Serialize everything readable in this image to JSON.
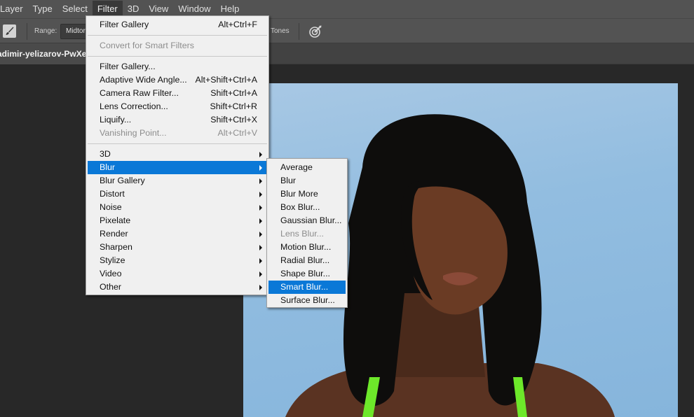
{
  "menubar": {
    "items": [
      "Layer",
      "Type",
      "Select",
      "Filter",
      "3D",
      "View",
      "Window",
      "Help"
    ],
    "active": "Filter"
  },
  "options_bar": {
    "tool_icon": "brush-icon",
    "range_label": "Range:",
    "range_value": "Midtones",
    "range_visible_text": "Midtor",
    "tones_label": "Tones",
    "airbrush_icon": "target-airbrush-icon"
  },
  "document": {
    "tab_title": "adimir-yelizarov-PwXek_"
  },
  "filter_menu": {
    "items": [
      {
        "label": "Filter Gallery",
        "shortcut": "Alt+Ctrl+F",
        "disabled": false
      },
      {
        "separator": true
      },
      {
        "label": "Convert for Smart Filters",
        "shortcut": "",
        "disabled": true
      },
      {
        "separator": true
      },
      {
        "label": "Filter Gallery...",
        "shortcut": "",
        "disabled": false
      },
      {
        "label": "Adaptive Wide Angle...",
        "shortcut": "Alt+Shift+Ctrl+A",
        "disabled": false
      },
      {
        "label": "Camera Raw Filter...",
        "shortcut": "Shift+Ctrl+A",
        "disabled": false
      },
      {
        "label": "Lens Correction...",
        "shortcut": "Shift+Ctrl+R",
        "disabled": false
      },
      {
        "label": "Liquify...",
        "shortcut": "Shift+Ctrl+X",
        "disabled": false
      },
      {
        "label": "Vanishing Point...",
        "shortcut": "Alt+Ctrl+V",
        "disabled": true
      },
      {
        "separator": true
      },
      {
        "label": "3D",
        "submenu": true
      },
      {
        "label": "Blur",
        "submenu": true,
        "highlighted": true
      },
      {
        "label": "Blur Gallery",
        "submenu": true
      },
      {
        "label": "Distort",
        "submenu": true
      },
      {
        "label": "Noise",
        "submenu": true
      },
      {
        "label": "Pixelate",
        "submenu": true
      },
      {
        "label": "Render",
        "submenu": true
      },
      {
        "label": "Sharpen",
        "submenu": true
      },
      {
        "label": "Stylize",
        "submenu": true
      },
      {
        "label": "Video",
        "submenu": true
      },
      {
        "label": "Other",
        "submenu": true
      }
    ]
  },
  "blur_submenu": {
    "items": [
      {
        "label": "Average",
        "disabled": false
      },
      {
        "label": "Blur",
        "disabled": false
      },
      {
        "label": "Blur More",
        "disabled": false
      },
      {
        "label": "Box Blur...",
        "disabled": false
      },
      {
        "label": "Gaussian Blur...",
        "disabled": false
      },
      {
        "label": "Lens Blur...",
        "disabled": true
      },
      {
        "label": "Motion Blur...",
        "disabled": false
      },
      {
        "label": "Radial Blur...",
        "disabled": false
      },
      {
        "label": "Shape Blur...",
        "disabled": false
      },
      {
        "label": "Smart Blur...",
        "disabled": false,
        "highlighted": true
      },
      {
        "label": "Surface Blur...",
        "disabled": false
      }
    ]
  },
  "colors": {
    "highlight": "#0a78d7",
    "menu_bg": "#f0f0f0",
    "chrome": "#535353",
    "workspace": "#282828"
  }
}
